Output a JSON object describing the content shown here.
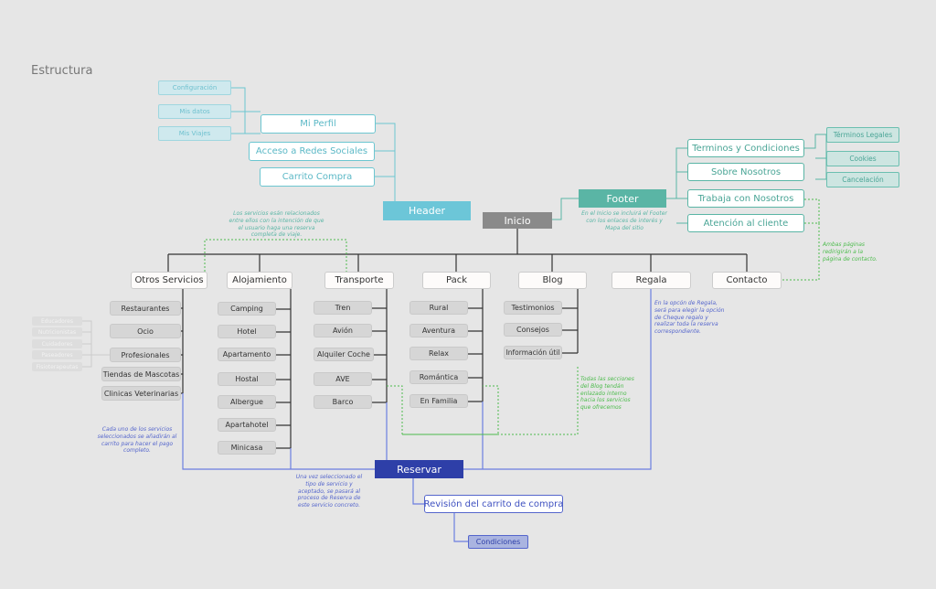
{
  "title": "Estructura",
  "header": {
    "label": "Header",
    "perfil_subitems": [
      "Configuración",
      "Mis datos",
      "Mis Viajes"
    ],
    "items": [
      "Mi Perfil",
      "Acceso a Redes Sociales",
      "Carrito Compra"
    ]
  },
  "inicio": "Inicio",
  "footer": {
    "label": "Footer",
    "note": "En el Inicio se incluirá el Footer\ncon los enlaces de interés y\nMapa del sitio",
    "items": [
      "Terminos y Condiciones",
      "Sobre Nosotros",
      "Trabaja con Nosotros",
      "Atención al cliente"
    ],
    "legal_items": [
      "Términos Legales",
      "Cookies",
      "Cancelación"
    ],
    "contact_note": "Ambas páginas\nredirigirán a la\npágina de contacto."
  },
  "sections": {
    "otros": {
      "label": "Otros Servicios",
      "items": [
        "Restaurantes",
        "Ocio",
        "Profesionales",
        "Tiendas de Mascotas",
        "Clinicas Veterinarias"
      ],
      "profesionales": [
        "Educadores",
        "Nutricionistas",
        "Cuidadores",
        "Paseadores",
        "Fisioterapeutas"
      ]
    },
    "alojamiento": {
      "label": "Alojamiento",
      "items": [
        "Camping",
        "Hotel",
        "Apartamento",
        "Hostal",
        "Albergue",
        "Apartahotel",
        "Minicasa"
      ]
    },
    "transporte": {
      "label": "Transporte",
      "items": [
        "Tren",
        "Avión",
        "Alquiler Coche",
        "AVE",
        "Barco"
      ]
    },
    "pack": {
      "label": "Pack",
      "items": [
        "Rural",
        "Aventura",
        "Relax",
        "Romántica",
        "En Familia"
      ]
    },
    "blog": {
      "label": "Blog",
      "items": [
        "Testimonios",
        "Consejos",
        "Información útil"
      ]
    },
    "regala": {
      "label": "Regala"
    },
    "contacto": {
      "label": "Contacto"
    }
  },
  "notes": {
    "servicios": "Los servicios esán relacionados\nentre ellos con la intención de que\nel usuario haga una reserva\ncompleta de viaje.",
    "carrito": "Cada uno de los servicios\nseleccionados se añadirán al\ncarrito para hacer el pago\ncompleto.",
    "reserva": "Una vez seleccionado el\ntipo de servicio y\naceptado, se pasará al\nproceso de Reserva de\neste servicio concreto.",
    "blog": "Todas las secciones\ndel Blog tendán\nenlazado interno\nhacia los servicios\nque ofrecemos",
    "regala": "En la opcón de Regala,\nserá para elegir la opción\nde Cheque regalo y\nrealizar toda la reserva\ncorrespondiente."
  },
  "booking": {
    "reservar": "Reservar",
    "revision": "Revisión del carrito de compra",
    "condiciones": "Condiciones"
  },
  "colors": {
    "teal": "#6cc6d8",
    "green": "#5ab5a5",
    "blue": "#2e3fa8",
    "gray": "#8a8a8a"
  }
}
